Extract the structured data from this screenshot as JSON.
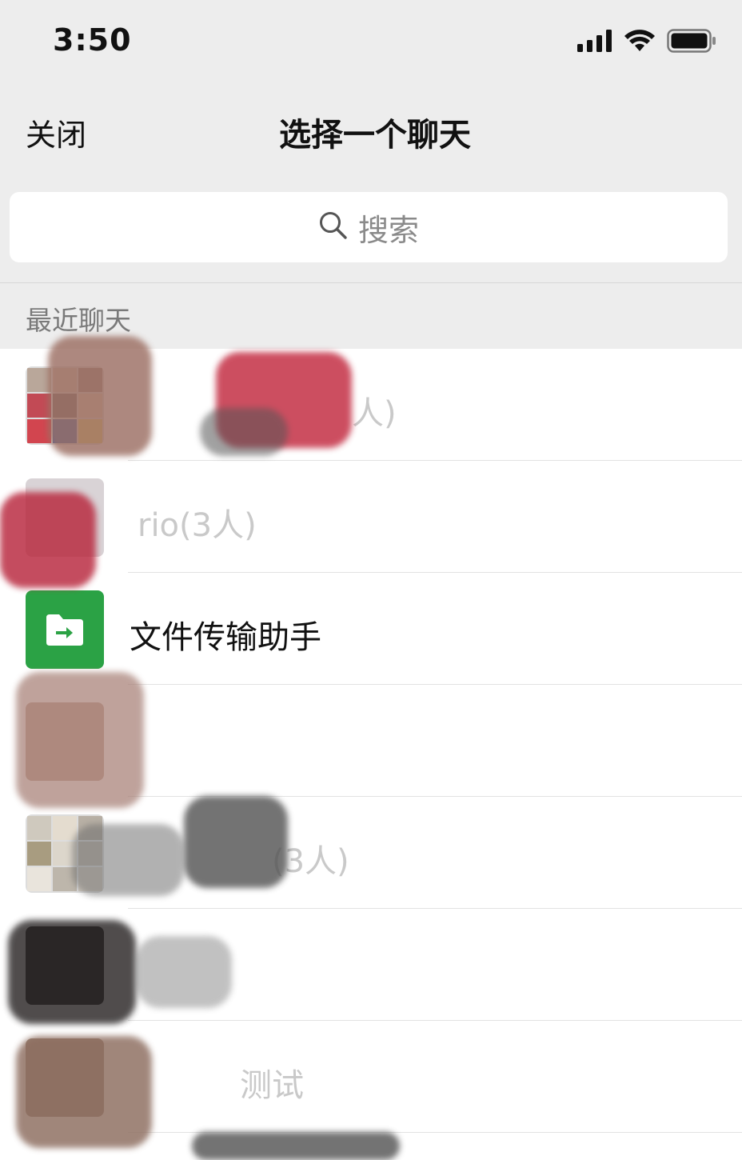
{
  "status_bar": {
    "time": "3:50",
    "icons": [
      "signal-icon",
      "wifi-icon",
      "battery-icon"
    ]
  },
  "nav": {
    "close_label": "关闭",
    "title": "选择一个聊天"
  },
  "search": {
    "placeholder": "搜索",
    "icon": "search-icon"
  },
  "recent_section": {
    "header": "最近聊天"
  },
  "chats": [
    {
      "name": "人)",
      "avatar": "group-avatar"
    },
    {
      "name": "rio(3人)",
      "avatar": "redacted-avatar"
    },
    {
      "name": "文件传输助手",
      "avatar": "file-transfer-icon"
    },
    {
      "name": "",
      "avatar": "redacted-avatar"
    },
    {
      "name": "(3人)",
      "avatar": "group-avatar"
    },
    {
      "name": "",
      "avatar": "redacted-avatar"
    },
    {
      "name": "测试",
      "avatar": "redacted-avatar"
    }
  ],
  "colors": {
    "background": "#ededed",
    "list_background": "#ffffff",
    "file_transfer_green": "#2ba245",
    "redaction_red": "#c2283e",
    "redaction_gray": "#555555"
  }
}
